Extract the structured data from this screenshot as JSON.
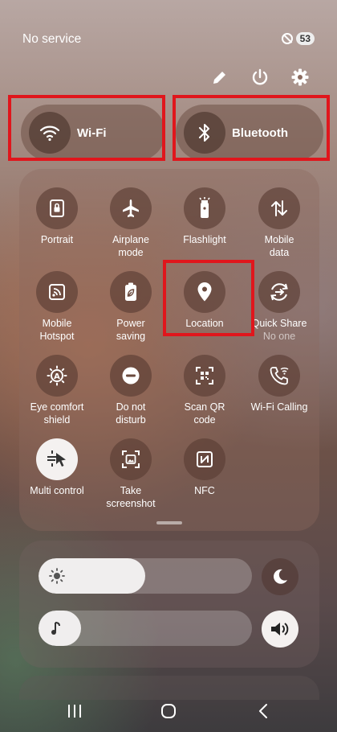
{
  "status": {
    "carrier": "No service",
    "battery": "53"
  },
  "top_actions": [
    "pencil-icon",
    "power-icon",
    "gear-icon"
  ],
  "big_tiles": {
    "wifi": "Wi-Fi",
    "bluetooth": "Bluetooth"
  },
  "tiles": {
    "portrait": "Portrait",
    "airplane": "Airplane\nmode",
    "flashlight": "Flashlight",
    "mobile_data": "Mobile\ndata",
    "hotspot": "Mobile\nHotspot",
    "power_saving": "Power\nsaving",
    "location": "Location",
    "quick_share": "Quick Share",
    "quick_share_sub": "No one",
    "eye_comfort": "Eye comfort\nshield",
    "dnd": "Do not\ndisturb",
    "scan_qr": "Scan QR\ncode",
    "wifi_calling": "Wi-Fi Calling",
    "multi_control": "Multi control",
    "screenshot": "Take\nscreenshot",
    "nfc": "NFC"
  },
  "sliders": {
    "brightness_level": 0.5,
    "media_volume_level": 0.2
  },
  "colors": {
    "highlight": "#e0161c",
    "tile_on": "#f4f1f0"
  }
}
